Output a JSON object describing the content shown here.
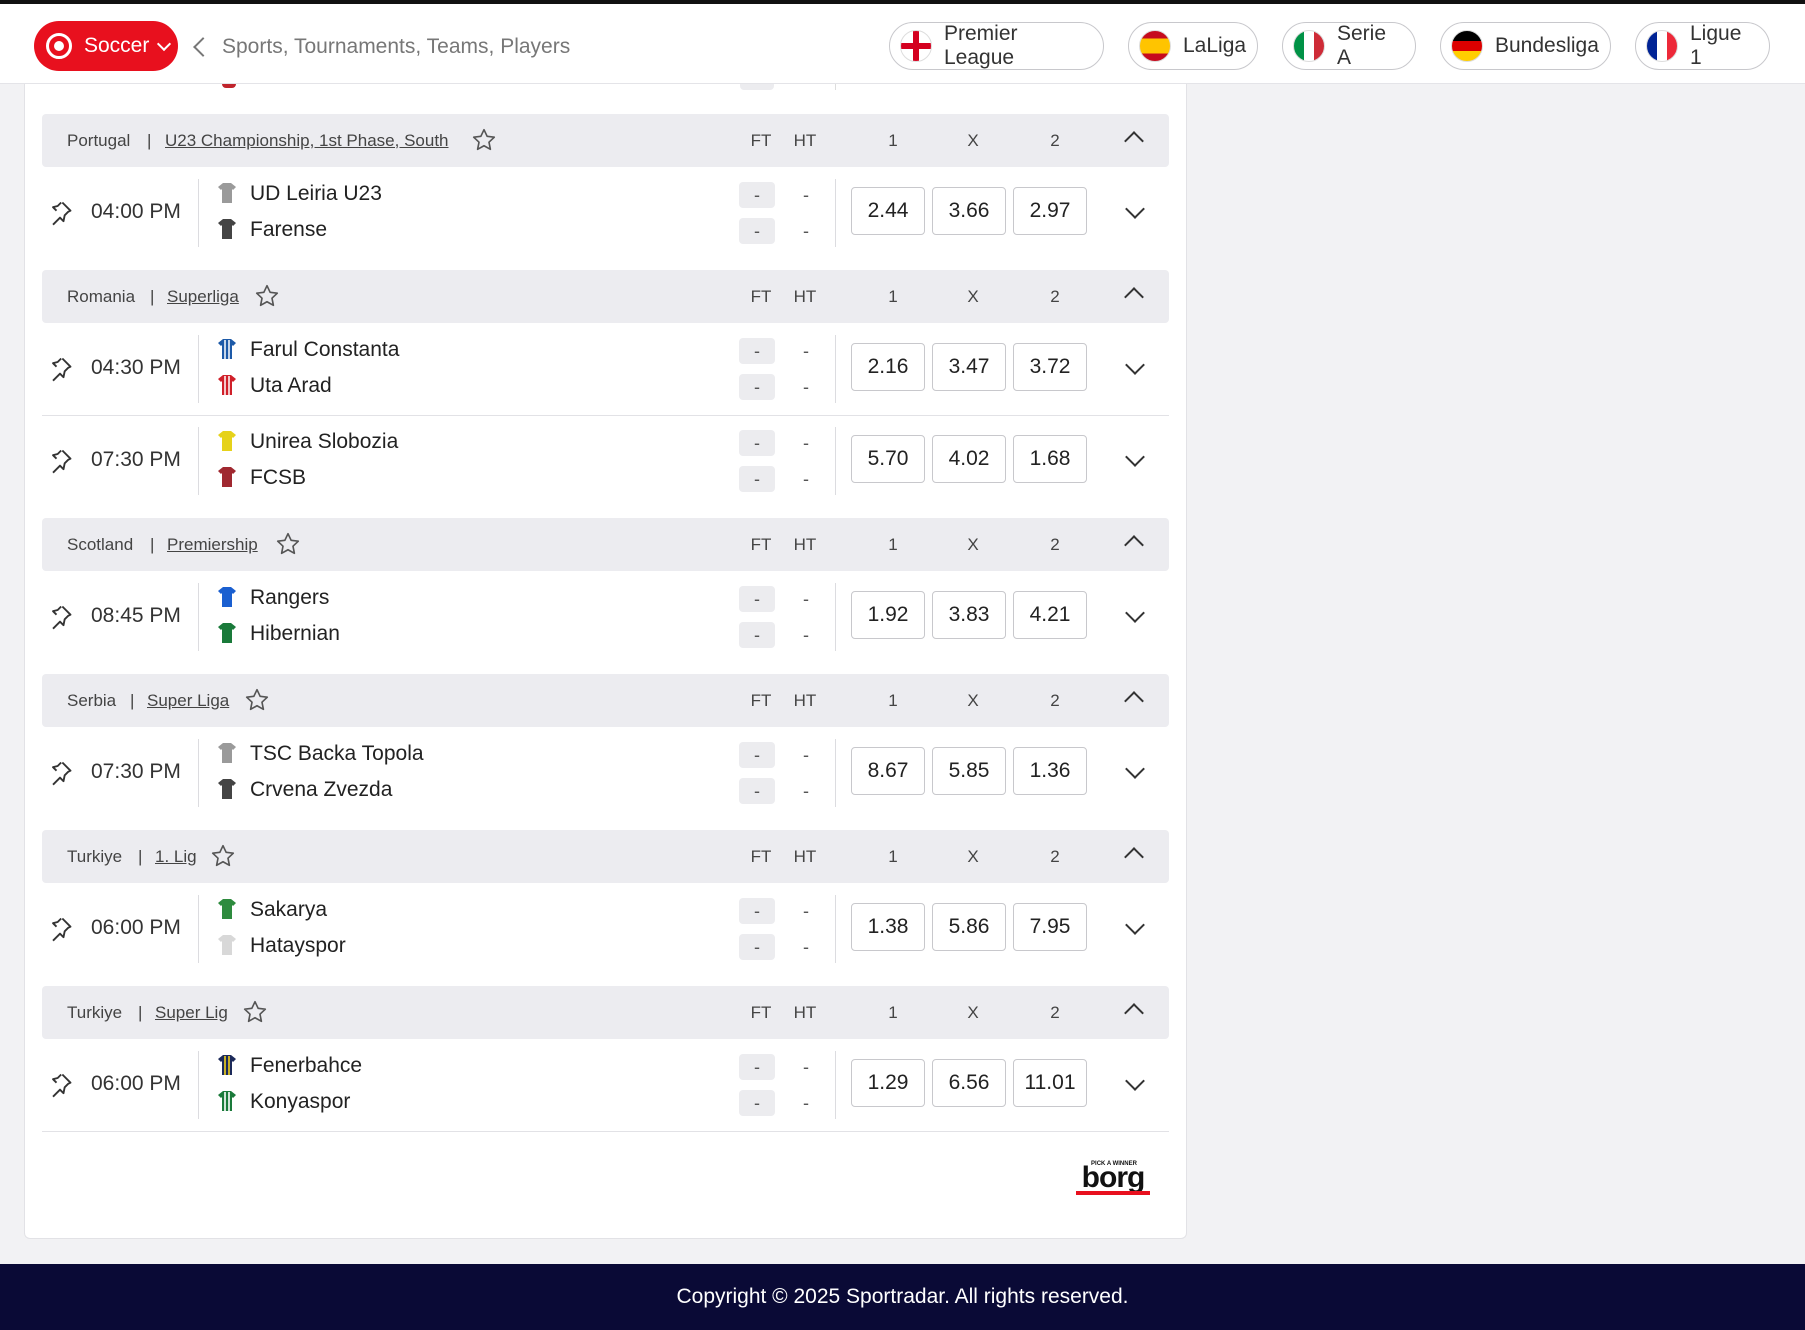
{
  "header": {
    "sport_label": "Soccer",
    "search_placeholder": "Sports, Tournaments, Teams, Players",
    "leagues": [
      {
        "label": "Premier League",
        "flag": "england"
      },
      {
        "label": "LaLiga",
        "flag": "spain"
      },
      {
        "label": "Serie A",
        "flag": "italy"
      },
      {
        "label": "Bundesliga",
        "flag": "germany"
      },
      {
        "label": "Ligue 1",
        "flag": "france"
      }
    ],
    "accent_color": "#e8101e"
  },
  "columns": {
    "ft": "FT",
    "ht": "HT",
    "home": "1",
    "draw": "X",
    "away": "2"
  },
  "sections": [
    {
      "country": "Portugal",
      "competition": "U23 Championship, 1st Phase, South",
      "matches": [
        {
          "time": "04:00 PM",
          "home": "UD Leiria U23",
          "away": "Farense",
          "home_jersey": "#9a9a9a",
          "away_jersey": "#444444",
          "home_ft": "-",
          "away_ft": "-",
          "home_ht": "-",
          "away_ht": "-",
          "odds": [
            "2.44",
            "3.66",
            "2.97"
          ]
        }
      ]
    },
    {
      "country": "Romania",
      "competition": "Superliga",
      "matches": [
        {
          "time": "04:30 PM",
          "home": "Farul Constanta",
          "away": "Uta Arad",
          "home_jersey": "#1d5aa8",
          "away_jersey": "#d0202a",
          "home_ft": "-",
          "away_ft": "-",
          "home_ht": "-",
          "away_ht": "-",
          "odds": [
            "2.16",
            "3.47",
            "3.72"
          ]
        },
        {
          "time": "07:30 PM",
          "home": "Unirea Slobozia",
          "away": "FCSB",
          "home_jersey": "#e6d21a",
          "away_jersey": "#a02830",
          "home_ft": "-",
          "away_ft": "-",
          "home_ht": "-",
          "away_ht": "-",
          "odds": [
            "5.70",
            "4.02",
            "1.68"
          ]
        }
      ]
    },
    {
      "country": "Scotland",
      "competition": "Premiership",
      "matches": [
        {
          "time": "08:45 PM",
          "home": "Rangers",
          "away": "Hibernian",
          "home_jersey": "#1a5fd0",
          "away_jersey": "#1a7a3a",
          "home_ft": "-",
          "away_ft": "-",
          "home_ht": "-",
          "away_ht": "-",
          "odds": [
            "1.92",
            "3.83",
            "4.21"
          ]
        }
      ]
    },
    {
      "country": "Serbia",
      "competition": "Super Liga",
      "matches": [
        {
          "time": "07:30 PM",
          "home": "TSC Backa Topola",
          "away": "Crvena Zvezda",
          "home_jersey": "#9a9a9a",
          "away_jersey": "#444444",
          "home_ft": "-",
          "away_ft": "-",
          "home_ht": "-",
          "away_ht": "-",
          "odds": [
            "8.67",
            "5.85",
            "1.36"
          ]
        }
      ]
    },
    {
      "country": "Turkiye",
      "competition": "1. Lig",
      "matches": [
        {
          "time": "06:00 PM",
          "home": "Sakarya",
          "away": "Hatayspor",
          "home_jersey": "#2e8b3e",
          "away_jersey": "#d8d8d8",
          "home_ft": "-",
          "away_ft": "-",
          "home_ht": "-",
          "away_ht": "-",
          "odds": [
            "1.38",
            "5.86",
            "7.95"
          ]
        }
      ]
    },
    {
      "country": "Turkiye",
      "competition": "Super Lig",
      "matches": [
        {
          "time": "06:00 PM",
          "home": "Fenerbahce",
          "away": "Konyaspor",
          "home_jersey": "#1c2a5a",
          "away_jersey": "#1a7a3a",
          "home_ft": "-",
          "away_ft": "-",
          "home_ht": "-",
          "away_ht": "-",
          "odds": [
            "1.29",
            "6.56",
            "11.01"
          ]
        }
      ]
    }
  ],
  "brand": {
    "logo_text": "borg",
    "logo_tagline": "PICK A WINNER"
  },
  "footer": {
    "copyright": "Copyright © 2025 Sportradar. All rights reserved."
  }
}
